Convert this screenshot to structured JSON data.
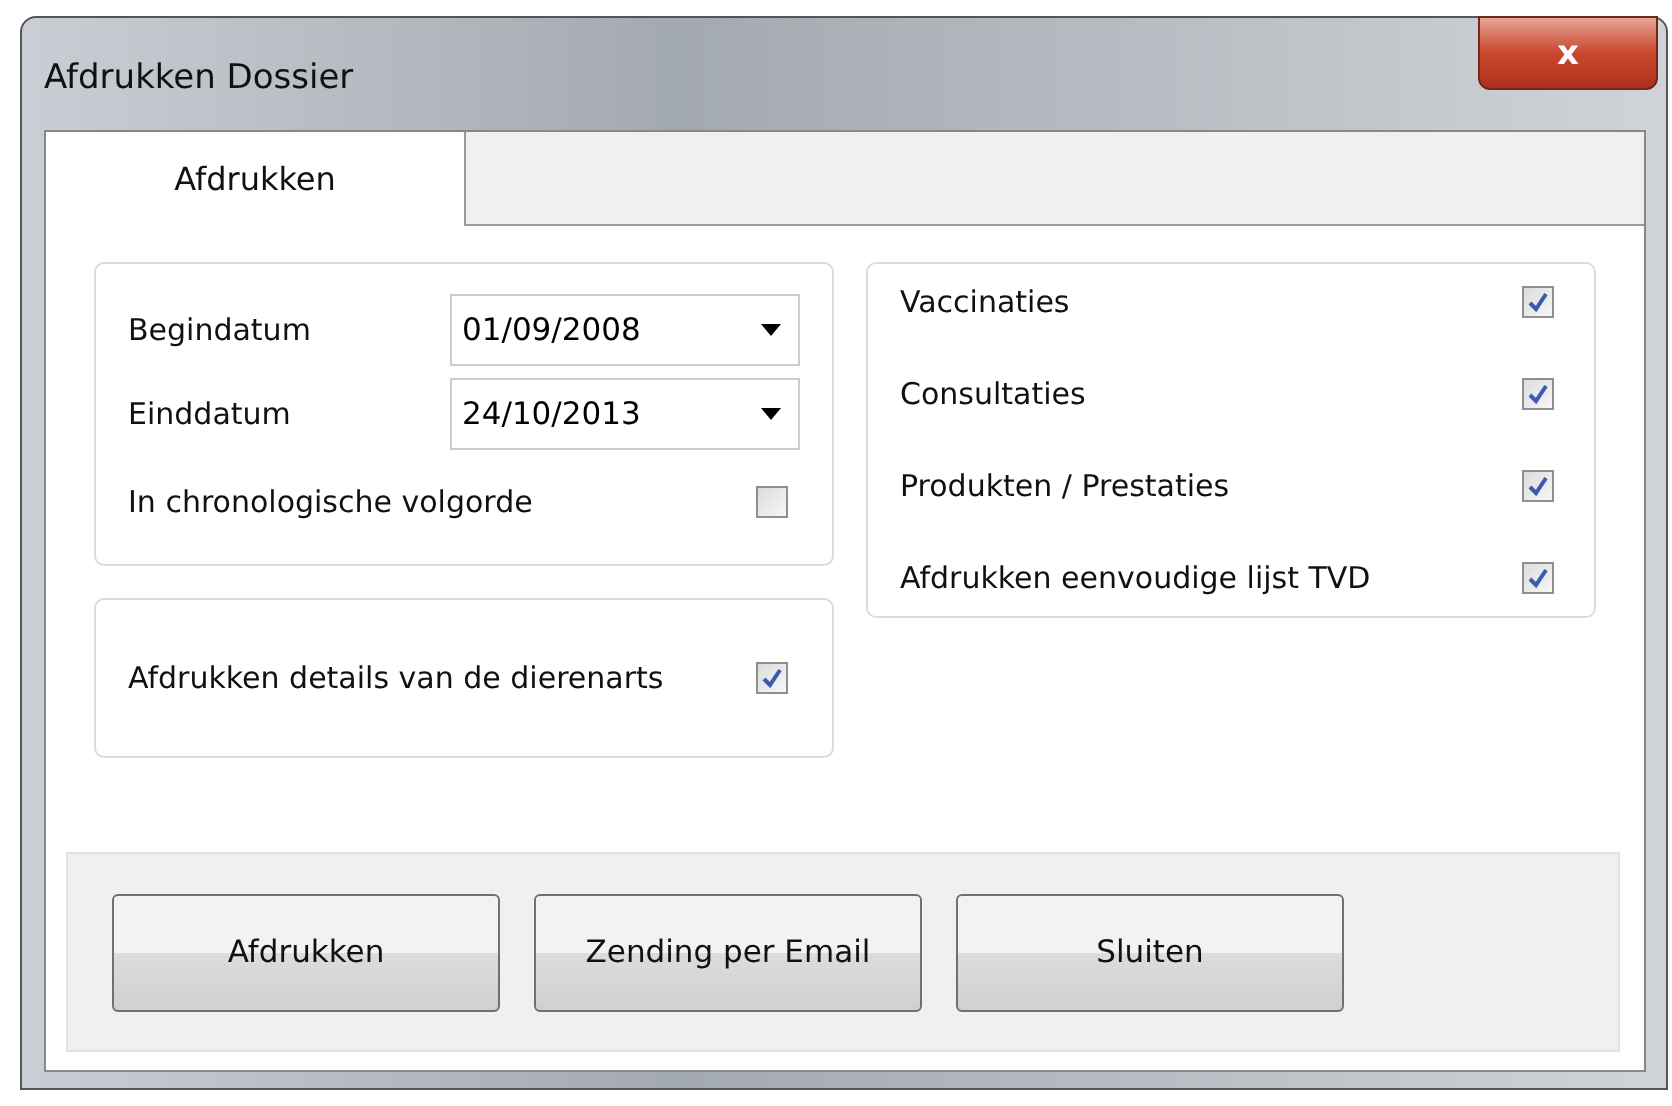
{
  "window": {
    "title": "Afdrukken Dossier",
    "close": "x"
  },
  "tabs": [
    {
      "label": "Afdrukken",
      "selected": true
    }
  ],
  "period": {
    "rows": [
      {
        "label": "Begindatum",
        "value": "01/09/2008"
      },
      {
        "label": "Einddatum",
        "value": "24/10/2013"
      }
    ],
    "chronological": {
      "label": "In chronologische volgorde",
      "checked": false
    }
  },
  "vet_details": {
    "label": "Afdrukken details van de dierenarts",
    "checked": true
  },
  "sections": [
    {
      "label": "Vaccinaties",
      "checked": true
    },
    {
      "label": "Consultaties",
      "checked": true
    },
    {
      "label": "Produkten / Prestaties",
      "checked": true
    },
    {
      "label": "Afdrukken eenvoudige lijst TVD",
      "checked": true
    }
  ],
  "buttons": [
    "Afdrukken",
    "Zending per Email",
    "Sluiten"
  ]
}
